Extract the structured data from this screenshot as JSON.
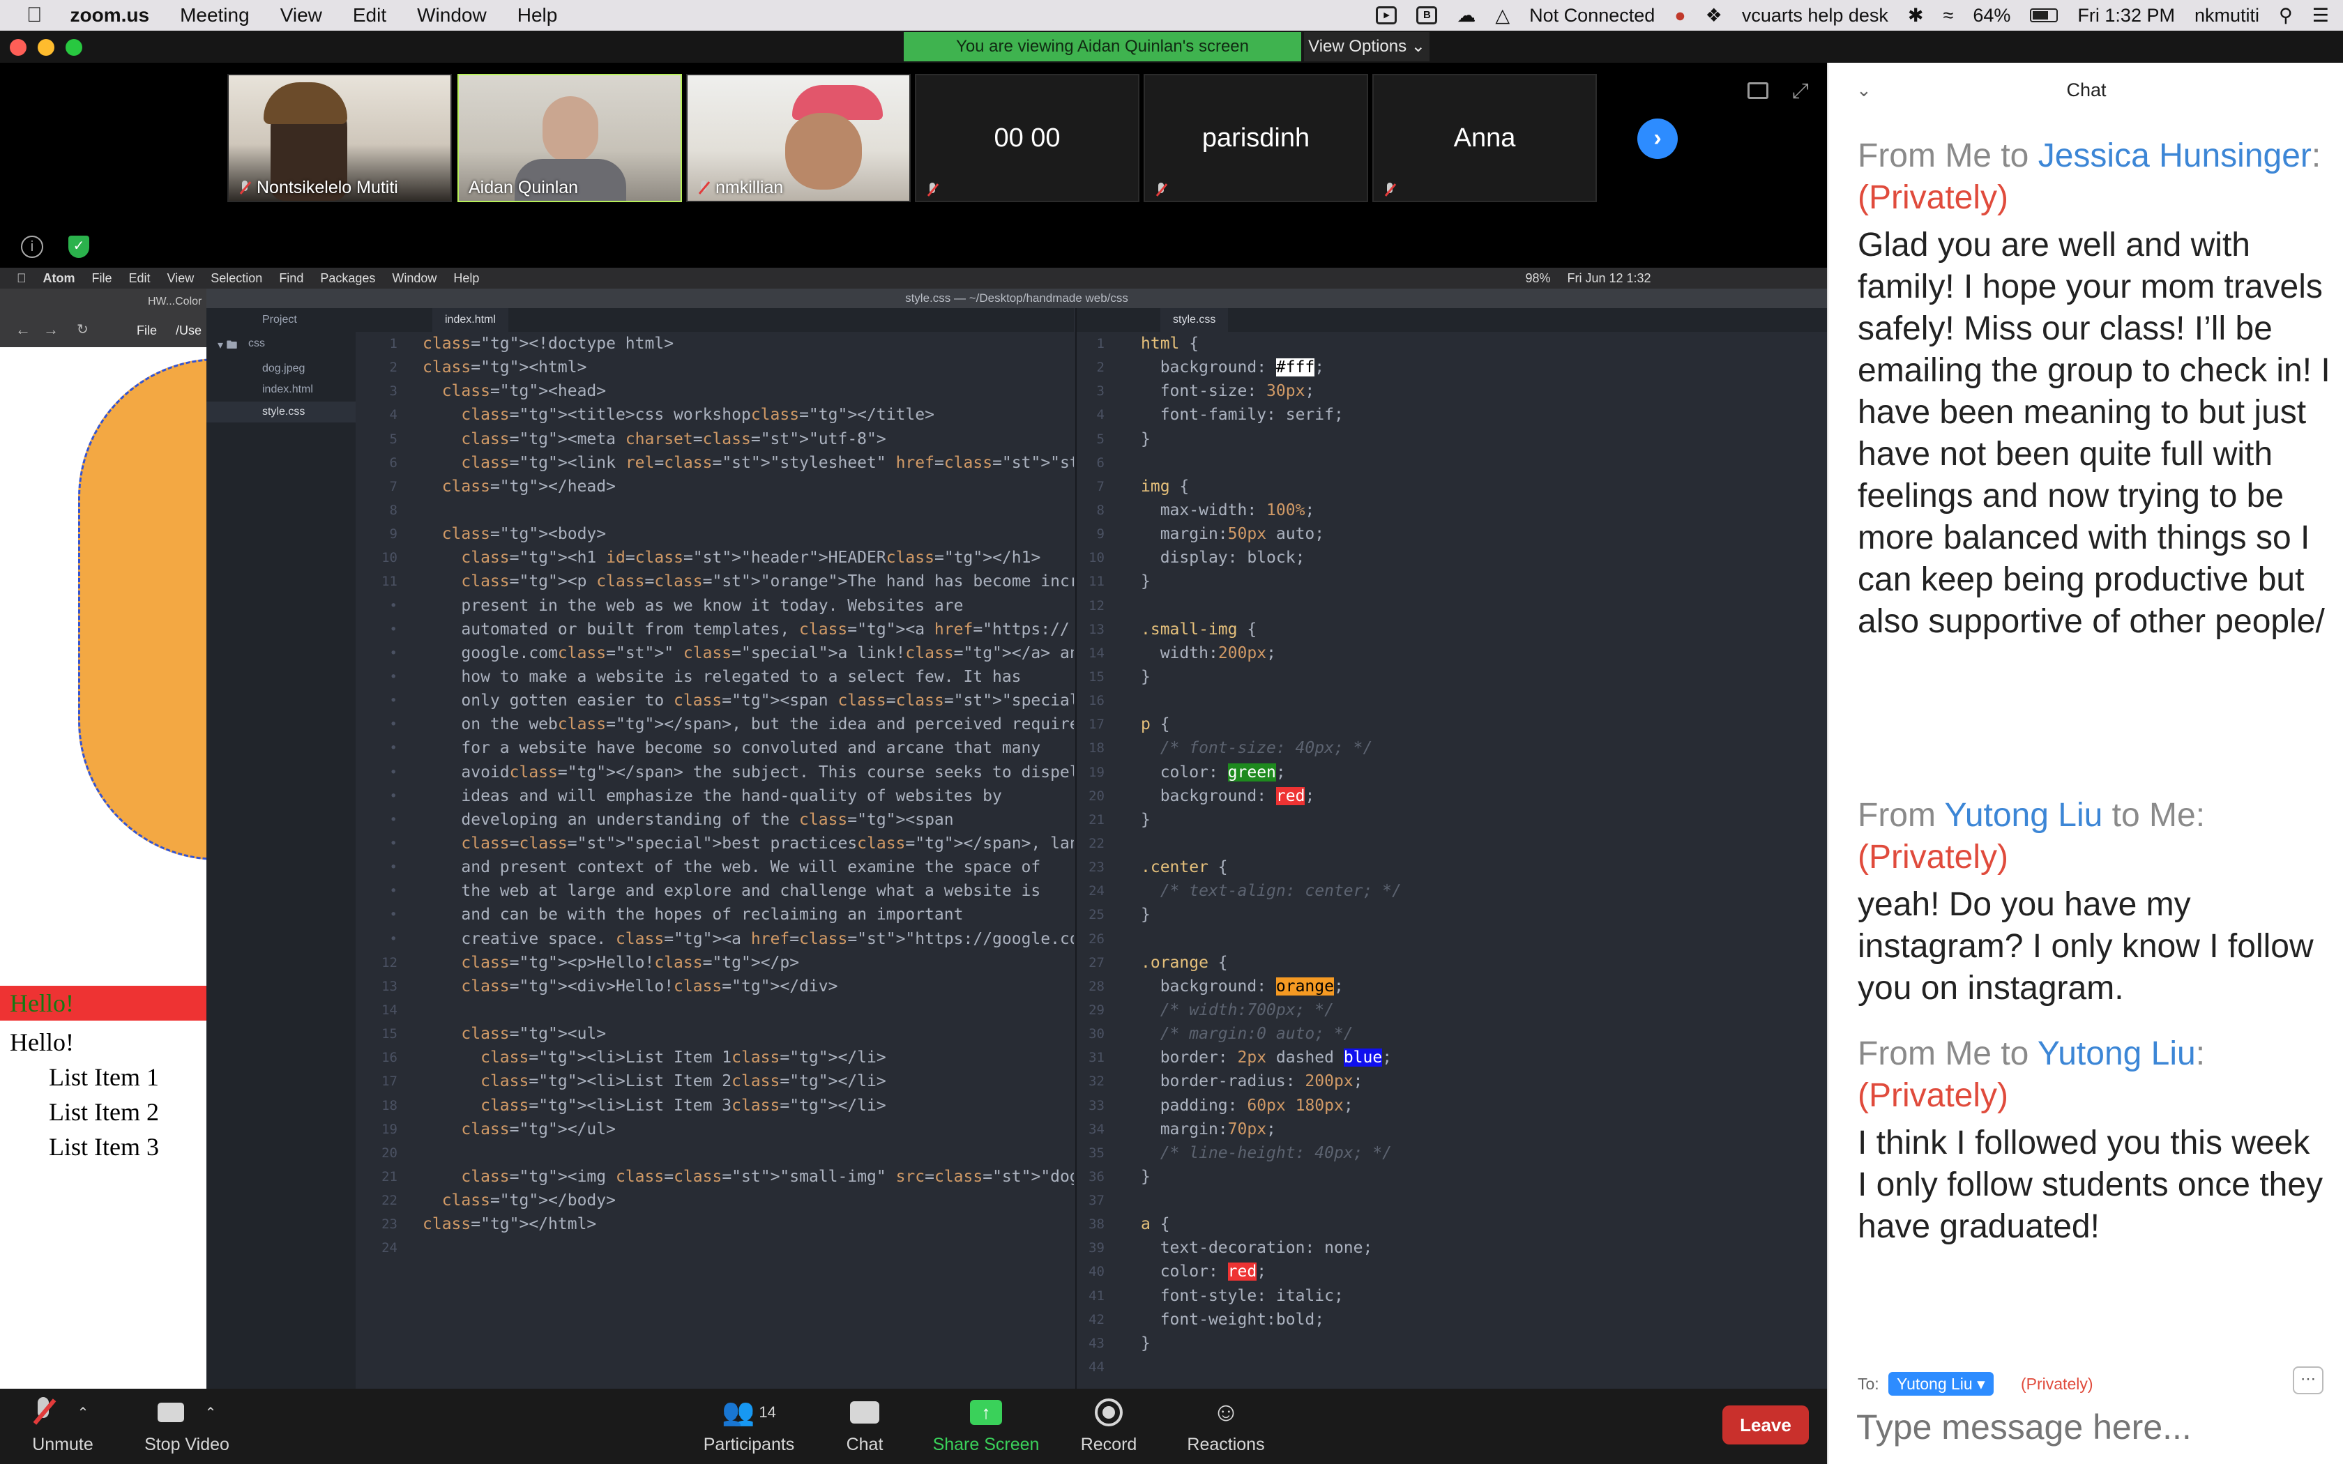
{
  "menubar": {
    "app": "zoom.us",
    "items": [
      "Meeting",
      "View",
      "Edit",
      "Window",
      "Help"
    ],
    "status": "Not Connected",
    "helpdesk": "vcuarts help desk",
    "battery": "64%",
    "clock": "Fri 1:32 PM",
    "user": "nkmutiti"
  },
  "banner": {
    "viewing": "You are viewing Aidan Quinlan's screen",
    "view_options": "View Options"
  },
  "participants": [
    {
      "name": "Nontsikelelo Mutiti"
    },
    {
      "name": "Aidan Quinlan"
    },
    {
      "name": "nmkillian"
    },
    {
      "name": "00 00"
    },
    {
      "name": "parisdinh"
    },
    {
      "name": "Anna"
    }
  ],
  "atom": {
    "menu": [
      "Atom",
      "File",
      "Edit",
      "View",
      "Selection",
      "Find",
      "Packages",
      "Window",
      "Help"
    ],
    "clock": "Fri Jun 12 1:32",
    "battery": "98%",
    "title": "style.css — ~/Desktop/handmade web/css",
    "tree": {
      "project": "Project",
      "folder": "css",
      "files": [
        "dog.jpeg",
        "index.html",
        "style.css"
      ]
    },
    "tab_left": "index.html",
    "tab_right": "style.css"
  },
  "browser": {
    "tab": "HW...Color",
    "address_file": "File",
    "address_path": "/Use",
    "hello1": "Hello!",
    "hello2": "Hello!",
    "list": [
      "List Item 1",
      "List Item 2",
      "List Item 3"
    ]
  },
  "html_lines": [
    "<!doctype html>",
    "<html>",
    "  <head>",
    "    <title>css workshop</title>",
    "    <meta charset=\"utf-8\">",
    "    <link rel=\"stylesheet\" href=\"style.css\">",
    "  </head>",
    "",
    "  <body>",
    "    <h1 id=\"header\">HEADER</h1>",
    "    <p class=\"orange\">The hand has become increasingly less",
    "    present in the web as we know it today. Websites are",
    "    automated or built from templates, <a href=\"https://",
    "    google.com\" class=\"special\">a link!</a> and the knowledge of",
    "    how to make a website is relegated to a select few. It has",
    "    only gotten easier to <span class=\"special\">learn and make",
    "    on the web</span>, but the idea and perceived requirements",
    "    for a website have become so convoluted and arcane that many",
    "    avoid</span> the subject. This course seeks to dispel these",
    "    ideas and will emphasize the hand-quality of websites by",
    "    developing an understanding of the <span",
    "    class=\"special\">best practices</span>, language, history,",
    "    and present context of the web. We will examine the space of",
    "    the web at large and explore and challenge what a website is",
    "    and can be with the hopes of reclaiming an important",
    "    creative space. <a href=\"https://google.com\">a link!</a></p>",
    "    <p>Hello!</p>",
    "    <div>Hello!</div>",
    "",
    "    <ul>",
    "      <li>List Item 1</li>",
    "      <li>List Item 2</li>",
    "      <li>List Item 3</li>",
    "    </ul>",
    "",
    "    <img class=\"small-img\" src=\"dog.jpeg\">",
    "  </body>",
    "</html>",
    ""
  ],
  "html_gutter": [
    "1",
    "2",
    "3",
    "4",
    "5",
    "6",
    "7",
    "8",
    "9",
    "10",
    "11",
    "•",
    "•",
    "•",
    "•",
    "•",
    "•",
    "•",
    "•",
    "•",
    "•",
    "•",
    "•",
    "•",
    "•",
    "•",
    "12",
    "13",
    "14",
    "15",
    "16",
    "17",
    "18",
    "19",
    "20",
    "21",
    "22",
    "23",
    "24"
  ],
  "css_lines": [
    "html {",
    "  background: #fff;",
    "  font-size: 30px;",
    "  font-family: serif;",
    "}",
    "",
    "img {",
    "  max-width: 100%;",
    "  margin:50px auto;",
    "  display: block;",
    "}",
    "",
    ".small-img {",
    "  width:200px;",
    "}",
    "",
    "p {",
    "  /* font-size: 40px; */",
    "  color: green;",
    "  background: red;",
    "}",
    "",
    ".center {",
    "  /* text-align: center; */",
    "}",
    "",
    ".orange {",
    "  background: orange;",
    "  /* width:700px; */",
    "  /* margin:0 auto; */",
    "  border: 2px dashed blue;",
    "  border-radius: 200px;",
    "  padding: 60px 180px;",
    "  margin:70px;",
    "  /* line-height: 40px; */",
    "}",
    "",
    "a {",
    "  text-decoration: none;",
    "  color: red;",
    "  font-style: italic;",
    "  font-weight:bold;",
    "}",
    ""
  ],
  "controls": {
    "unmute": "Unmute",
    "stop_video": "Stop Video",
    "participants": "Participants",
    "participants_count": "14",
    "chat": "Chat",
    "share_screen": "Share Screen",
    "record": "Record",
    "reactions": "Reactions",
    "leave": "Leave"
  },
  "chat": {
    "title": "Chat",
    "messages": [
      {
        "from": "From Me to ",
        "to": "Jessica Hunsinger",
        "colon": ":",
        "privately": "(Privately)",
        "text": "Glad you are well and with family! I hope your mom travels safely! Miss our class! I’ll be emailing the group to check in! I have been meaning to but just have not been quite full with feelings and now trying to be more balanced with things so I can keep being productive but also supportive of other people/"
      },
      {
        "from": "From ",
        "sender": "Yutong Liu",
        "to_me": " to Me: ",
        "privately": "(Privately)",
        "text": "yeah! Do you have my instagram? I only know I follow you on instagram."
      },
      {
        "from": "From Me to ",
        "to": "Yutong Liu",
        "colon": ": ",
        "privately": "(Privately)",
        "text_lines": [
          "I think I followed you this week",
          "I only follow students once they have graduated!"
        ]
      }
    ],
    "to_label": "To:",
    "recipient": "Yutong Liu",
    "recipient_mode": "(Privately)",
    "input_placeholder": "Type message here..."
  }
}
